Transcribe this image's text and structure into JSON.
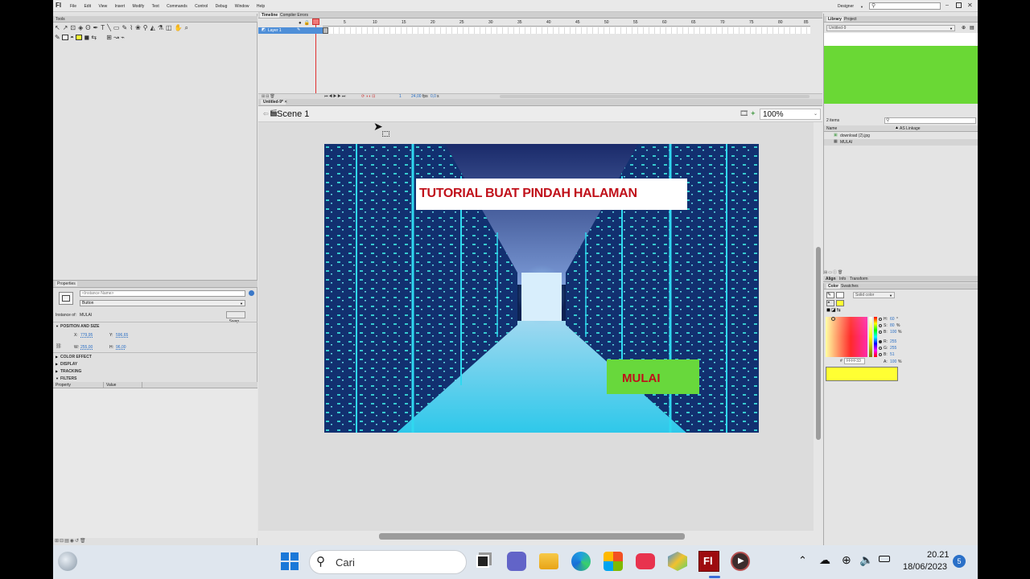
{
  "app": {
    "logo": "Fl",
    "menu": [
      "File",
      "Edit",
      "View",
      "Insert",
      "Modify",
      "Text",
      "Commands",
      "Control",
      "Debug",
      "Window",
      "Help"
    ],
    "workspace": "Designer",
    "window_controls": [
      "minimize",
      "maximize",
      "close"
    ]
  },
  "tools_panel": {
    "title": "Tools"
  },
  "timeline": {
    "tabs": [
      "Timeline",
      "Compiler Errors"
    ],
    "layer_name": "Layer 1",
    "frame_numbers": [
      "5",
      "10",
      "15",
      "20",
      "25",
      "30",
      "35",
      "40",
      "45",
      "50",
      "55",
      "60",
      "65",
      "70",
      "75",
      "80",
      "85"
    ],
    "fps": "24,00",
    "fps_unit": "fps",
    "time": "0,0",
    "time_unit": "s",
    "current_frame": "1"
  },
  "document": {
    "tab_label": "Untitled-9*",
    "scene_label": "Scene 1",
    "zoom": "100%"
  },
  "stage": {
    "title_text": "TUTORIAL BUAT PINDAH HALAMAN",
    "button_text": "MULAI",
    "colors": {
      "title_text": "#c0101a",
      "button_bg": "#68d83c",
      "button_text": "#c0101a"
    }
  },
  "properties": {
    "tab": "Properties",
    "instance_name_placeholder": "<Instance Name>",
    "type_value": "Button",
    "instance_of_label": "Instance of:",
    "instance_of_value": "MULAI",
    "swap_button": "Swap...",
    "position_section": "POSITION AND SIZE",
    "x_label": "X:",
    "x_value": "779,95",
    "y_label": "Y:",
    "y_value": "596,65",
    "w_label": "W:",
    "w_value": "255,00",
    "h_label": "H:",
    "h_value": "96,00",
    "sections": [
      "COLOR EFFECT",
      "DISPLAY",
      "TRACKING",
      "FILTERS"
    ],
    "filters_columns": [
      "Property",
      "Value"
    ]
  },
  "library": {
    "tabs": [
      "Library",
      "Project"
    ],
    "document": "Untitled-9",
    "preview_color": "#6ad835",
    "item_count": "2 items",
    "columns": [
      "Name",
      "AS Linkage"
    ],
    "items": [
      "download (2).jpg",
      "MULAI"
    ]
  },
  "align_tabs": [
    "Align",
    "Info",
    "Transform"
  ],
  "color_panel": {
    "tabs": [
      "Color",
      "Swatches"
    ],
    "type": "Solid color",
    "hsb": [
      {
        "label": "H:",
        "value": "60",
        "unit": "°"
      },
      {
        "label": "S:",
        "value": "80",
        "unit": "%"
      },
      {
        "label": "B:",
        "value": "100",
        "unit": "%"
      }
    ],
    "rgb": [
      {
        "label": "R:",
        "value": "255"
      },
      {
        "label": "G:",
        "value": "255"
      },
      {
        "label": "B:",
        "value": "51"
      }
    ],
    "alpha_label": "A:",
    "alpha_value": "100",
    "alpha_unit": "%",
    "hex": "FFFF33",
    "swatch_color": "#ffff33"
  },
  "taskbar": {
    "search_placeholder": "Cari",
    "time": "20.21",
    "date": "18/06/2023",
    "notification_count": "5"
  }
}
